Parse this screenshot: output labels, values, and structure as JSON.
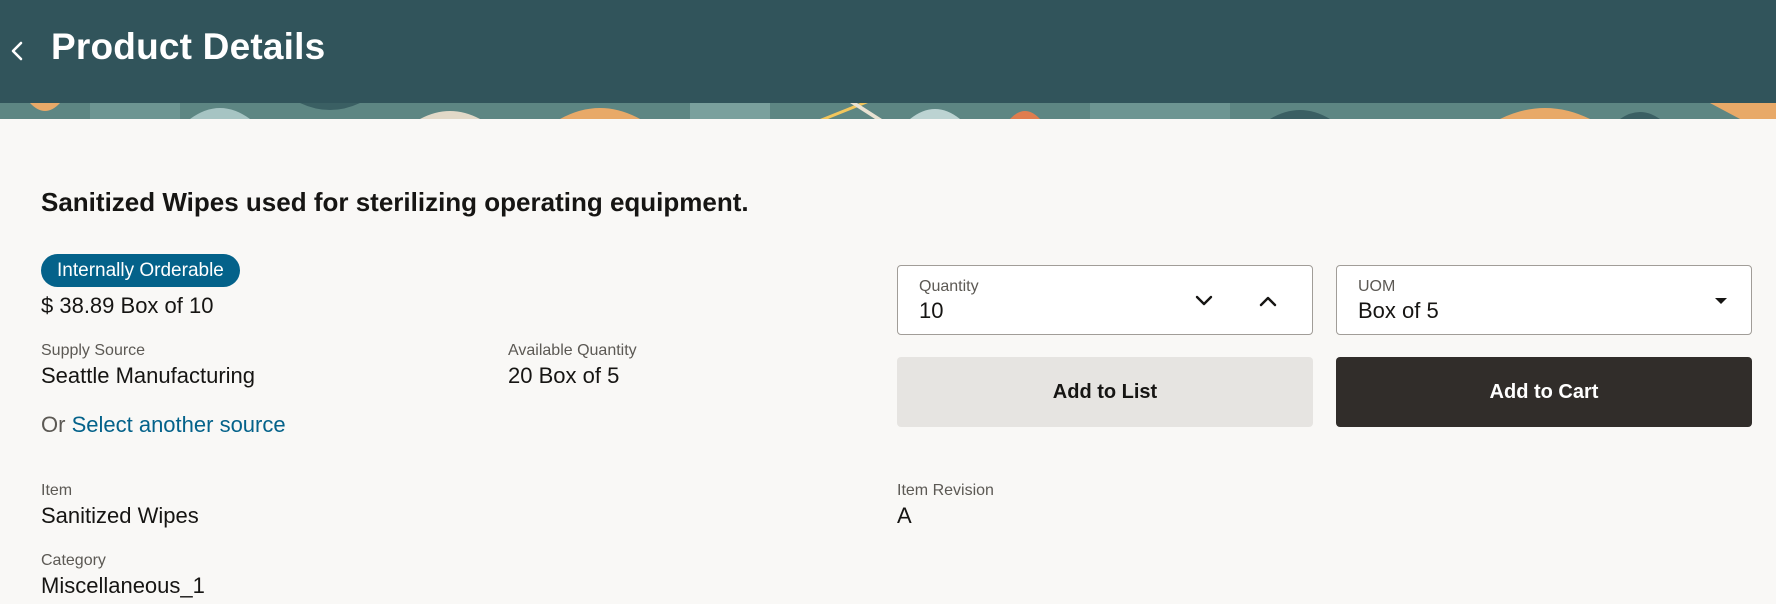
{
  "header": {
    "title": "Product Details",
    "back_icon": "chevron-left-icon"
  },
  "product": {
    "description": "Sanitized Wipes used for sterilizing operating equipment.",
    "badge": "Internally Orderable",
    "price": "$ 38.89 Box of 10",
    "supply_source_label": "Supply Source",
    "supply_source_value": "Seattle Manufacturing",
    "available_qty_label": "Available Quantity",
    "available_qty_value": "20 Box of 5",
    "or_text": "Or",
    "select_source_link": "Select another source",
    "item_label": "Item",
    "item_value": "Sanitized Wipes",
    "item_revision_label": "Item Revision",
    "item_revision_value": "A",
    "category_label": "Category",
    "category_value": "Miscellaneous_1"
  },
  "order": {
    "quantity_label": "Quantity",
    "quantity_value": "10",
    "uom_label": "UOM",
    "uom_value": "Box of 5",
    "add_to_list": "Add to List",
    "add_to_cart": "Add to Cart"
  },
  "colors": {
    "header_bg": "#31545b",
    "badge_bg": "#04628a",
    "link": "#04628a",
    "primary_button": "#312d2a",
    "secondary_button": "#e6e4e1",
    "page_bg": "#f9f8f6"
  }
}
